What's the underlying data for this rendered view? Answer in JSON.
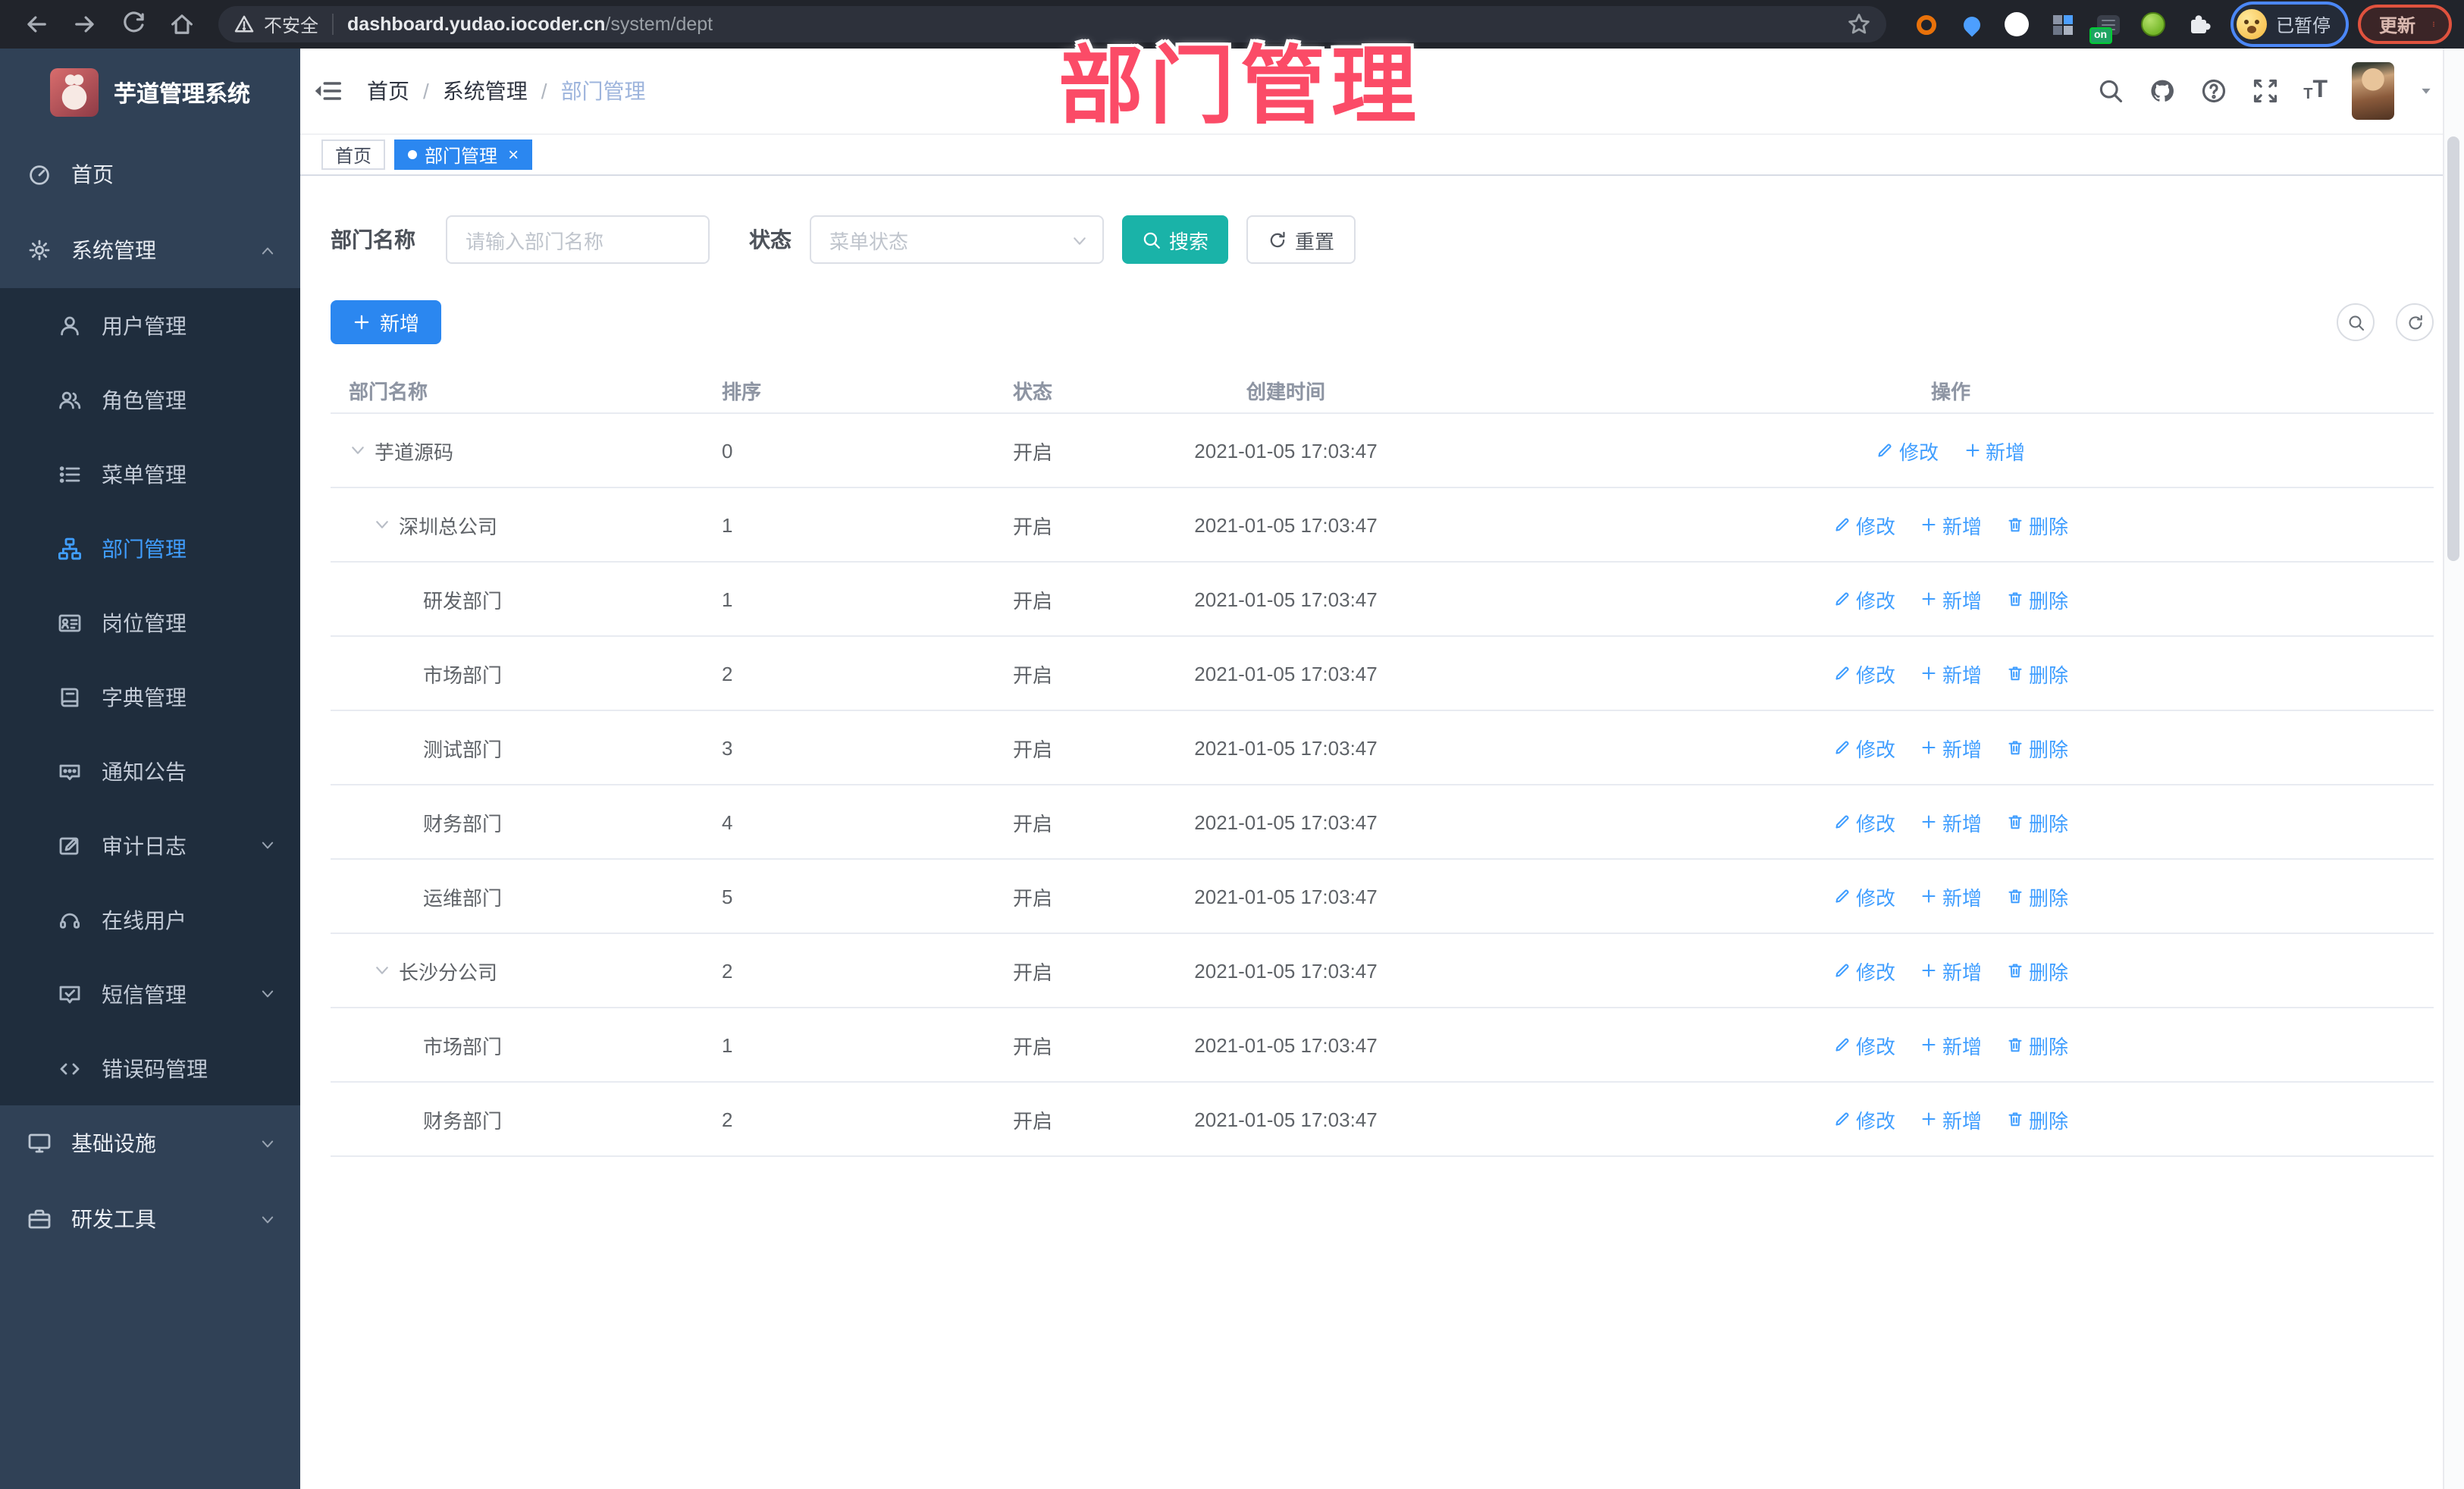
{
  "colors": {
    "accent": "#2b87f0",
    "link": "#409eff",
    "teal": "#1ab3a8",
    "pink": "#fb4b67",
    "sidebar_bg": "#304156",
    "submenu_bg": "#1f2d3d",
    "browser_bar": "#21242b"
  },
  "browser": {
    "security_label": "不安全",
    "url_host": "dashboard.yudao.iocoder.cn",
    "url_path": "/system/dept",
    "profile_badge": "已暂停",
    "update_label": "更新",
    "extensions": [
      {
        "name": "extension-orange-ring",
        "type": "ring",
        "color": "#e8710a"
      },
      {
        "name": "extension-location-pin",
        "type": "pin",
        "color": "#4d9fff"
      },
      {
        "name": "extension-green-check",
        "type": "check",
        "color": "#27b24a"
      },
      {
        "name": "extension-grid",
        "type": "grid",
        "color": "#8a93a5"
      },
      {
        "name": "extension-dark-list",
        "type": "list-badge",
        "color": "#3a3f4a",
        "badge": "on"
      },
      {
        "name": "extension-green-figure",
        "type": "figure",
        "color": "#76b82a"
      },
      {
        "name": "extension-puzzle",
        "type": "puzzle",
        "color": "#e9ebef"
      }
    ]
  },
  "sidebar": {
    "app_title": "芋道管理系统",
    "items": [
      {
        "label": "首页",
        "icon": "dashboard-icon",
        "level": 0,
        "active": false,
        "chevron": "none"
      },
      {
        "label": "系统管理",
        "icon": "gear-icon",
        "level": 0,
        "active": false,
        "chevron": "up"
      },
      {
        "label": "用户管理",
        "icon": "user-icon",
        "level": 1,
        "active": false,
        "chevron": "none"
      },
      {
        "label": "角色管理",
        "icon": "users-icon",
        "level": 1,
        "active": false,
        "chevron": "none"
      },
      {
        "label": "菜单管理",
        "icon": "menu-list-icon",
        "level": 1,
        "active": false,
        "chevron": "none"
      },
      {
        "label": "部门管理",
        "icon": "org-tree-icon",
        "level": 1,
        "active": true,
        "chevron": "none"
      },
      {
        "label": "岗位管理",
        "icon": "id-card-icon",
        "level": 1,
        "active": false,
        "chevron": "none"
      },
      {
        "label": "字典管理",
        "icon": "dictionary-icon",
        "level": 1,
        "active": false,
        "chevron": "none"
      },
      {
        "label": "通知公告",
        "icon": "announcement-icon",
        "level": 1,
        "active": false,
        "chevron": "none"
      },
      {
        "label": "审计日志",
        "icon": "audit-log-icon",
        "level": 1,
        "active": false,
        "chevron": "down"
      },
      {
        "label": "在线用户",
        "icon": "online-user-icon",
        "level": 1,
        "active": false,
        "chevron": "none"
      },
      {
        "label": "短信管理",
        "icon": "sms-icon",
        "level": 1,
        "active": false,
        "chevron": "down"
      },
      {
        "label": "错误码管理",
        "icon": "error-code-icon",
        "level": 1,
        "active": false,
        "chevron": "none"
      },
      {
        "label": "基础设施",
        "icon": "infrastructure-icon",
        "level": 0,
        "active": false,
        "chevron": "down"
      },
      {
        "label": "研发工具",
        "icon": "dev-tools-icon",
        "level": 0,
        "active": false,
        "chevron": "down"
      }
    ]
  },
  "header": {
    "breadcrumb": [
      "首页",
      "系统管理",
      "部门管理"
    ],
    "separator": "/"
  },
  "tabs": [
    {
      "label": "首页",
      "active": false,
      "closable": false
    },
    {
      "label": "部门管理",
      "active": true,
      "closable": true,
      "close_label": "×"
    }
  ],
  "watermark": {
    "text": "部门管理"
  },
  "search_form": {
    "name_label": "部门名称",
    "name_placeholder": "请输入部门名称",
    "status_label": "状态",
    "status_placeholder": "菜单状态",
    "search_label": "搜索",
    "reset_label": "重置"
  },
  "toolbar": {
    "add_label": "新增"
  },
  "table": {
    "columns": [
      "部门名称",
      "排序",
      "状态",
      "创建时间",
      "操作"
    ],
    "rows": [
      {
        "name": "芋道源码",
        "level": 0,
        "expandable": true,
        "sort": "0",
        "status": "开启",
        "created": "2021-01-05 17:03:47",
        "actions": [
          {
            "label": "修改",
            "icon": "edit-icon"
          },
          {
            "label": "新增",
            "icon": "plus-icon"
          }
        ]
      },
      {
        "name": "深圳总公司",
        "level": 1,
        "expandable": true,
        "sort": "1",
        "status": "开启",
        "created": "2021-01-05 17:03:47",
        "actions": [
          {
            "label": "修改",
            "icon": "edit-icon"
          },
          {
            "label": "新增",
            "icon": "plus-icon"
          },
          {
            "label": "删除",
            "icon": "delete-icon"
          }
        ]
      },
      {
        "name": "研发部门",
        "level": 2,
        "expandable": false,
        "sort": "1",
        "status": "开启",
        "created": "2021-01-05 17:03:47",
        "actions": [
          {
            "label": "修改",
            "icon": "edit-icon"
          },
          {
            "label": "新增",
            "icon": "plus-icon"
          },
          {
            "label": "删除",
            "icon": "delete-icon"
          }
        ]
      },
      {
        "name": "市场部门",
        "level": 2,
        "expandable": false,
        "sort": "2",
        "status": "开启",
        "created": "2021-01-05 17:03:47",
        "actions": [
          {
            "label": "修改",
            "icon": "edit-icon"
          },
          {
            "label": "新增",
            "icon": "plus-icon"
          },
          {
            "label": "删除",
            "icon": "delete-icon"
          }
        ]
      },
      {
        "name": "测试部门",
        "level": 2,
        "expandable": false,
        "sort": "3",
        "status": "开启",
        "created": "2021-01-05 17:03:47",
        "actions": [
          {
            "label": "修改",
            "icon": "edit-icon"
          },
          {
            "label": "新增",
            "icon": "plus-icon"
          },
          {
            "label": "删除",
            "icon": "delete-icon"
          }
        ]
      },
      {
        "name": "财务部门",
        "level": 2,
        "expandable": false,
        "sort": "4",
        "status": "开启",
        "created": "2021-01-05 17:03:47",
        "actions": [
          {
            "label": "修改",
            "icon": "edit-icon"
          },
          {
            "label": "新增",
            "icon": "plus-icon"
          },
          {
            "label": "删除",
            "icon": "delete-icon"
          }
        ]
      },
      {
        "name": "运维部门",
        "level": 2,
        "expandable": false,
        "sort": "5",
        "status": "开启",
        "created": "2021-01-05 17:03:47",
        "actions": [
          {
            "label": "修改",
            "icon": "edit-icon"
          },
          {
            "label": "新增",
            "icon": "plus-icon"
          },
          {
            "label": "删除",
            "icon": "delete-icon"
          }
        ]
      },
      {
        "name": "长沙分公司",
        "level": 1,
        "expandable": true,
        "sort": "2",
        "status": "开启",
        "created": "2021-01-05 17:03:47",
        "actions": [
          {
            "label": "修改",
            "icon": "edit-icon"
          },
          {
            "label": "新增",
            "icon": "plus-icon"
          },
          {
            "label": "删除",
            "icon": "delete-icon"
          }
        ]
      },
      {
        "name": "市场部门",
        "level": 2,
        "expandable": false,
        "sort": "1",
        "status": "开启",
        "created": "2021-01-05 17:03:47",
        "actions": [
          {
            "label": "修改",
            "icon": "edit-icon"
          },
          {
            "label": "新增",
            "icon": "plus-icon"
          },
          {
            "label": "删除",
            "icon": "delete-icon"
          }
        ]
      },
      {
        "name": "财务部门",
        "level": 2,
        "expandable": false,
        "sort": "2",
        "status": "开启",
        "created": "2021-01-05 17:03:47",
        "actions": [
          {
            "label": "修改",
            "icon": "edit-icon"
          },
          {
            "label": "新增",
            "icon": "plus-icon"
          },
          {
            "label": "删除",
            "icon": "delete-icon"
          }
        ]
      }
    ]
  }
}
